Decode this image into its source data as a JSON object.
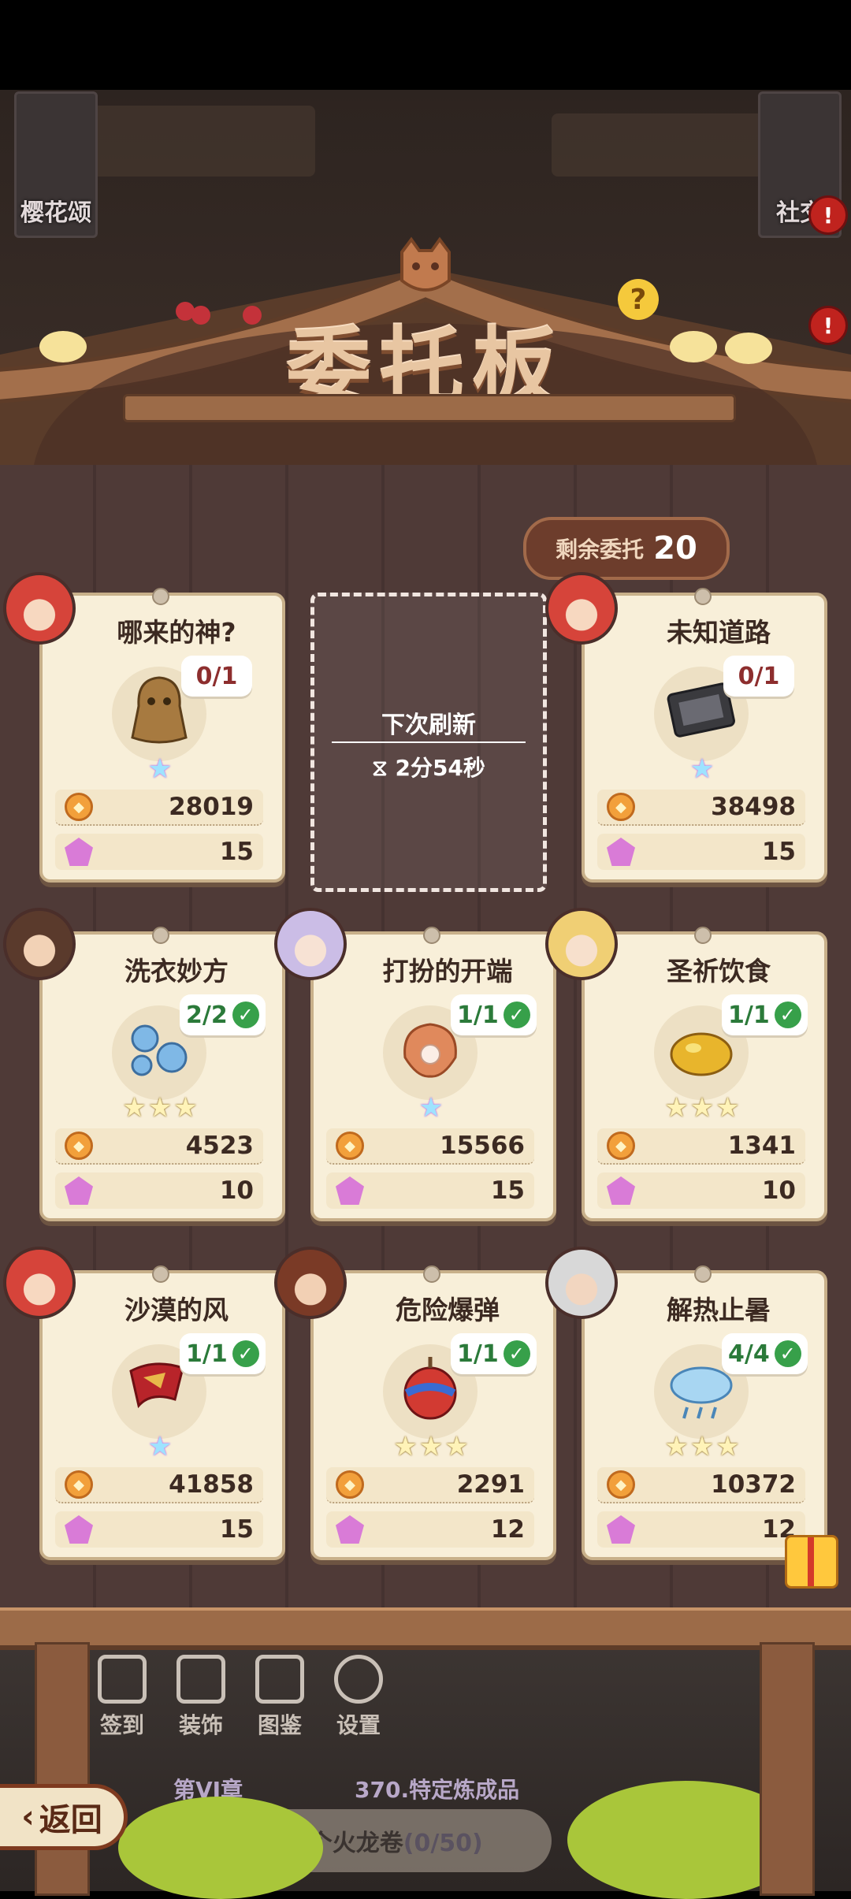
{
  "side_banners": {
    "left": "樱花颂",
    "right": "社交"
  },
  "title": "委托板",
  "remaining": {
    "label": "剩余委托",
    "count": "20"
  },
  "refresh": {
    "label": "下次刷新",
    "time": "2分54秒"
  },
  "cards": [
    {
      "name": "哪来的神?",
      "progress": "0/1",
      "done": false,
      "stars": 1,
      "coins": "28019",
      "gems": "15"
    },
    {
      "name": "未知道路",
      "progress": "0/1",
      "done": false,
      "stars": 1,
      "coins": "38498",
      "gems": "15"
    },
    {
      "name": "洗衣妙方",
      "progress": "2/2",
      "done": true,
      "stars": 3,
      "coins": "4523",
      "gems": "10"
    },
    {
      "name": "打扮的开端",
      "progress": "1/1",
      "done": true,
      "stars": 1,
      "coins": "15566",
      "gems": "15"
    },
    {
      "name": "圣祈饮食",
      "progress": "1/1",
      "done": true,
      "stars": 3,
      "coins": "1341",
      "gems": "10"
    },
    {
      "name": "沙漠的风",
      "progress": "1/1",
      "done": true,
      "stars": 1,
      "coins": "41858",
      "gems": "15"
    },
    {
      "name": "危险爆弹",
      "progress": "1/1",
      "done": true,
      "stars": 3,
      "coins": "2291",
      "gems": "12"
    },
    {
      "name": "解热止暑",
      "progress": "4/4",
      "done": true,
      "stars": 3,
      "coins": "10372",
      "gems": "12"
    }
  ],
  "toolbar": {
    "signin": "签到",
    "decor": "装饰",
    "atlas": "图鉴",
    "settings": "设置"
  },
  "quest": {
    "chapter": "第VI章",
    "title": "370.特定炼成品",
    "desc": "售50个火龙卷",
    "progress": "(0/50)"
  },
  "back_label": "返回",
  "colors": {
    "accent": "#9c6b48",
    "paper": "#f8efd9",
    "done_green": "#37a04a",
    "pending_red": "#8d2e2e"
  }
}
